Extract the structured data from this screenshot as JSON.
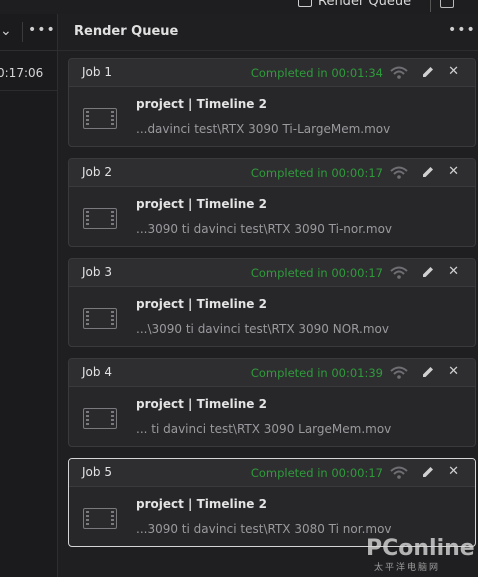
{
  "top": {
    "render_queue_label": "Render Queue"
  },
  "left_panel": {
    "timecode": "0:17:06"
  },
  "render_queue": {
    "title": "Render Queue",
    "jobs": [
      {
        "label": "Job 1",
        "status": "Completed in 00:01:34",
        "name": "project | Timeline 2",
        "path": "...davinci test\\RTX 3090 Ti-LargeMem.mov"
      },
      {
        "label": "Job 2",
        "status": "Completed in 00:00:17",
        "name": "project | Timeline 2",
        "path": "...3090 ti davinci test\\RTX 3090 Ti-nor.mov"
      },
      {
        "label": "Job 3",
        "status": "Completed in 00:00:17",
        "name": "project | Timeline 2",
        "path": "...\\3090 ti davinci test\\RTX 3090 NOR.mov"
      },
      {
        "label": "Job 4",
        "status": "Completed in 00:01:39",
        "name": "project | Timeline 2",
        "path": "... ti davinci test\\RTX 3090 LargeMem.mov"
      },
      {
        "label": "Job 5",
        "status": "Completed in 00:00:17",
        "name": "project | Timeline 2",
        "path": "...3090 ti davinci test\\RTX 3080 Ti nor.mov"
      }
    ]
  },
  "watermark": {
    "brand": "PConline",
    "sub": "太平洋电脑网"
  },
  "colors": {
    "status_green": "#2e9b3a",
    "panel_bg": "#1f1f21",
    "job_bg": "#27272a"
  }
}
